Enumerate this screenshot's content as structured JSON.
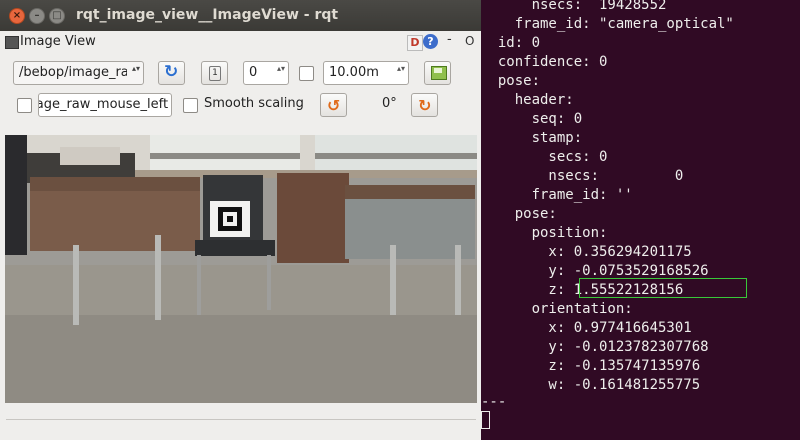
{
  "window": {
    "title": "rqt_image_view__ImageView - rqt",
    "close_glyph": "×",
    "min_glyph": "–",
    "max_glyph": "□"
  },
  "plugin": {
    "title": "Image View",
    "d_label": "D",
    "help_label": "?",
    "dash_label": "-",
    "o_label": "O"
  },
  "toolbar": {
    "topic": "/bebop/image_raw",
    "topic_arrows": "▴▾",
    "refresh_glyph": "↻",
    "num_glyph": "1",
    "num_value": "0",
    "spin_arrows": "▴▾",
    "distance_value": "10.00m",
    "mouse_topic": "/bebop/image_raw_mouse_left",
    "smooth_label": "Smooth scaling",
    "rotate_left_glyph": "↺",
    "angle": "0°",
    "rotate_right_glyph": "↻"
  },
  "terminal": {
    "lines": [
      "      nsecs:  19428552",
      "    frame_id: \"camera_optical\"",
      "  id: 0",
      "  confidence: 0",
      "  pose:",
      "    header:",
      "      seq: 0",
      "      stamp:",
      "        secs: 0",
      "        nsecs:         0",
      "      frame_id: ''",
      "    pose:",
      "      position:",
      "        x: 0.356294201175",
      "        y: -0.0753529168526",
      "        z: 1.55522128156",
      "      orientation:",
      "        x: 0.977416645301",
      "        y: -0.0123782307768",
      "        z: -0.135747135976",
      "        w: -0.161481255775",
      "---"
    ]
  },
  "colors": {
    "terminal_bg": "#300a24",
    "terminal_fg": "#eeeeec",
    "highlight": "#39c739",
    "accent_orange": "#e06a1a"
  }
}
